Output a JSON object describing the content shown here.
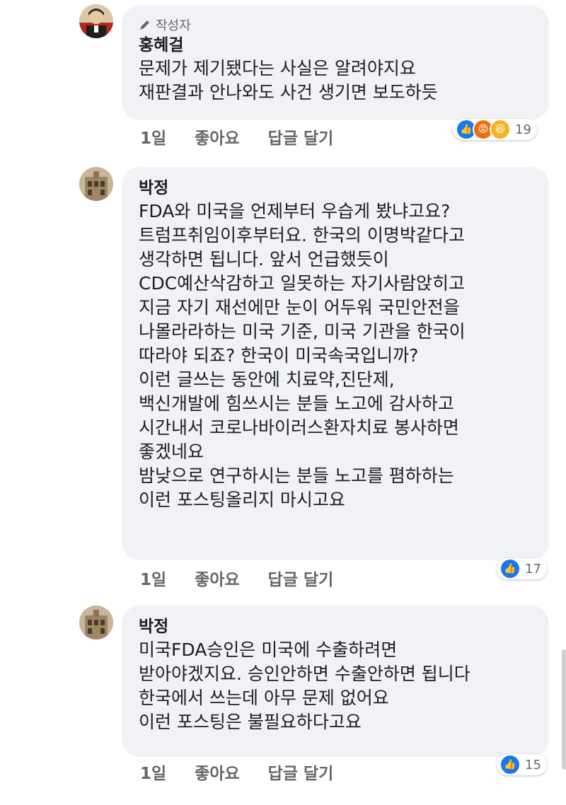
{
  "comments": [
    {
      "author_badge": "작성자",
      "author": "홍혜걸",
      "lines": [
        "문제가 제기됐다는 사실은 알려야지요",
        "재판결과 안나와도 사건 생기면 보도하듯"
      ],
      "time": "1일",
      "like_label": "좋아요",
      "reply_label": "답글 달기",
      "reaction_count": "19",
      "reaction_icons": [
        "like-icon",
        "angry-icon",
        "haha-icon"
      ]
    },
    {
      "author": "박정",
      "lines": [
        "FDA와 미국을 언제부터 우습게 봤냐고요?",
        "트럼프취임이후부터요. 한국의 이명박같다고",
        "생각하면 됩니다. 앞서 언급했듯이",
        "CDC예산삭감하고 일못하는 자기사람앉히고",
        "지금 자기 재선에만 눈이 어두워 국민안전을",
        "나몰라라하는 미국 기준, 미국 기관을 한국이",
        "따라야 되죠? 한국이 미국속국입니까?",
        "이런 글쓰는 동안에 치료약,진단제,",
        "백신개발에 힘쓰시는 분들 노고에 감사하고",
        "시간내서 코로나바이러스환자치료 봉사하면",
        "좋겠네요",
        "밤낮으로 연구하시는 분들 노고를 폄하하는",
        "이런 포스팅올리지 마시고요"
      ],
      "time": "1일",
      "like_label": "좋아요",
      "reply_label": "답글 달기",
      "reaction_count": "17",
      "reaction_icons": [
        "like-icon"
      ]
    },
    {
      "author": "박정",
      "lines": [
        "미국FDA승인은 미국에 수출하려면",
        "받아야겠지요. 승인안하면 수출안하면 됩니다",
        "한국에서 쓰는데 아무 문제 없어요",
        "이런 포스팅은 불필요하다고요"
      ],
      "time": "1일",
      "like_label": "좋아요",
      "reply_label": "답글 달기",
      "reaction_count": "15",
      "reaction_icons": [
        "like-icon"
      ]
    }
  ]
}
